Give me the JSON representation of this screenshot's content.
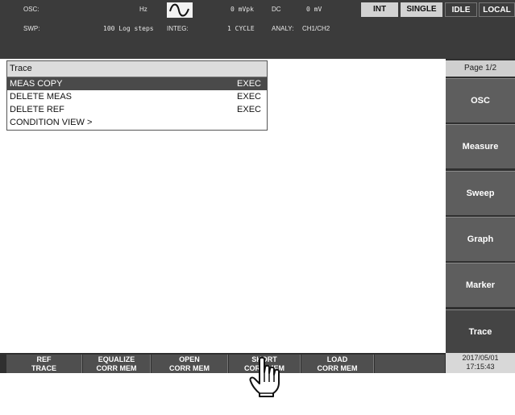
{
  "status": {
    "osc_label": "OSC:",
    "osc_unit": "Hz",
    "amp_value": "0 mVpk",
    "dc_label": "DC",
    "dc_value": "0 mV",
    "swp_label": "SWP:",
    "swp_value": "100 Log steps",
    "integ_label": "INTEG:",
    "integ_value": "1 CYCLE",
    "analy_label": "ANALY:",
    "analy_value": "CH1/CH2",
    "int_label": "INT",
    "single_label": "SINGLE",
    "idle_label": "IDLE",
    "local_label": "LOCAL",
    "waveform_icon": "sine-wave-icon"
  },
  "menu": {
    "title": "Trace",
    "items": [
      {
        "label": "MEAS COPY",
        "action": "EXEC",
        "selected": true
      },
      {
        "label": "DELETE MEAS",
        "action": "EXEC",
        "selected": false
      },
      {
        "label": "DELETE REF",
        "action": "EXEC",
        "selected": false
      },
      {
        "label": "CONDITION VIEW >",
        "action": "",
        "selected": false
      }
    ]
  },
  "side": {
    "page": "Page 1/2",
    "buttons": [
      "OSC",
      "Measure",
      "Sweep",
      "Graph",
      "Marker",
      "Trace"
    ],
    "active": "Trace"
  },
  "bottom": {
    "buttons": [
      {
        "line1": "REF",
        "line2": "TRACE"
      },
      {
        "line1": "EQUALIZE",
        "line2": "CORR MEM"
      },
      {
        "line1": "OPEN",
        "line2": "CORR MEM"
      },
      {
        "line1": "SHORT",
        "line2": "CORR MEM"
      },
      {
        "line1": "LOAD",
        "line2": "CORR MEM"
      }
    ],
    "date": "2017/05/01",
    "time": "17:15:43"
  },
  "cursor_icon": "hand-pointer-icon",
  "colors": {
    "status_bg": "#3b3b3b",
    "softkey_bg": "#5e5e5e",
    "selected_row": "#4a4a4a"
  }
}
